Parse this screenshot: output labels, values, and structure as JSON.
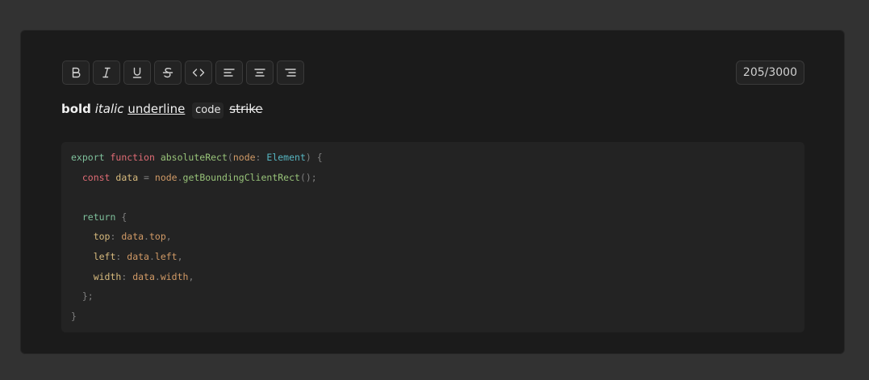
{
  "toolbar": {
    "buttons": [
      {
        "name": "bold-button",
        "icon": "bold-icon"
      },
      {
        "name": "italic-button",
        "icon": "italic-icon"
      },
      {
        "name": "underline-button",
        "icon": "underline-icon"
      },
      {
        "name": "strikethrough-button",
        "icon": "strikethrough-icon"
      },
      {
        "name": "code-button",
        "icon": "code-icon"
      },
      {
        "name": "align-left-button",
        "icon": "align-left-icon"
      },
      {
        "name": "align-center-button",
        "icon": "align-center-icon"
      },
      {
        "name": "align-right-button",
        "icon": "align-right-icon"
      }
    ]
  },
  "counter": "205/3000",
  "rich_text": {
    "bold": "bold",
    "italic": "italic",
    "underline": "underline",
    "code": "code",
    "strike": "strike"
  },
  "code": {
    "l1_export": "export",
    "l1_function": "function",
    "l1_name": "absoluteRect",
    "l1_open": "(",
    "l1_param": "node",
    "l1_colon": ": ",
    "l1_type": "Element",
    "l1_close": ") {",
    "l2_const": "const",
    "l2_var": "data",
    "l2_eq": " = ",
    "l2_obj": "node",
    "l2_dot": ".",
    "l2_call": "getBoundingClientRect",
    "l2_end": "();",
    "l4_return": "return",
    "l4_brace": " {",
    "l5_key": "top",
    "l5_colon": ": ",
    "l5_obj": "data",
    "l5_dot": ".",
    "l5_prop": "top",
    "l5_comma": ",",
    "l6_key": "left",
    "l6_colon": ": ",
    "l6_obj": "data",
    "l6_dot": ".",
    "l6_prop": "left",
    "l6_comma": ",",
    "l7_key": "width",
    "l7_colon": ": ",
    "l7_obj": "data",
    "l7_dot": ".",
    "l7_prop": "width",
    "l7_comma": ",",
    "l8_end": "};",
    "l9_end": "}"
  },
  "colors": {
    "background": "#323232",
    "card": "#1b1b1b",
    "code_background": "#232323"
  }
}
